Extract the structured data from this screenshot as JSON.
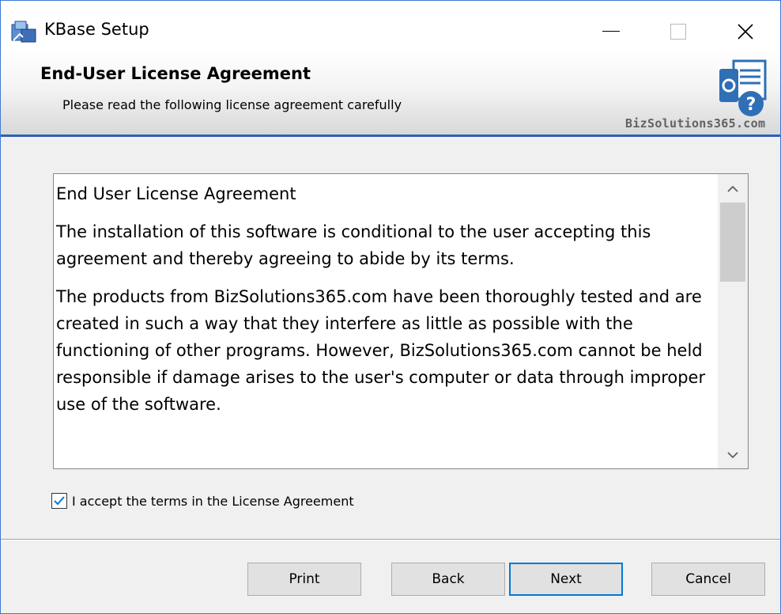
{
  "window": {
    "title": "KBase Setup",
    "icon": "installer-icon"
  },
  "header": {
    "title": "End-User License Agreement",
    "subtitle": "Please read the following license agreement carefully",
    "logo_text": "BizSolutions365.com"
  },
  "eula": {
    "paragraphs": [
      "End User License Agreement",
      "The installation of this software is conditional to the user accepting this agreement and thereby agreeing to abide by its terms.",
      "The products from BizSolutions365.com have been thoroughly tested and are created in such a way that they interfere as little as possible with the functioning of other programs. However, BizSolutions365.com cannot be held responsible if damage arises to the user's computer or data through improper use of the software."
    ]
  },
  "accept": {
    "label": "I accept the terms in the License Agreement",
    "checked": true
  },
  "buttons": {
    "print": "Print",
    "back": "Back",
    "next": "Next",
    "cancel": "Cancel"
  },
  "colors": {
    "accent": "#0078d7",
    "header_rule": "#2e5fb5"
  }
}
